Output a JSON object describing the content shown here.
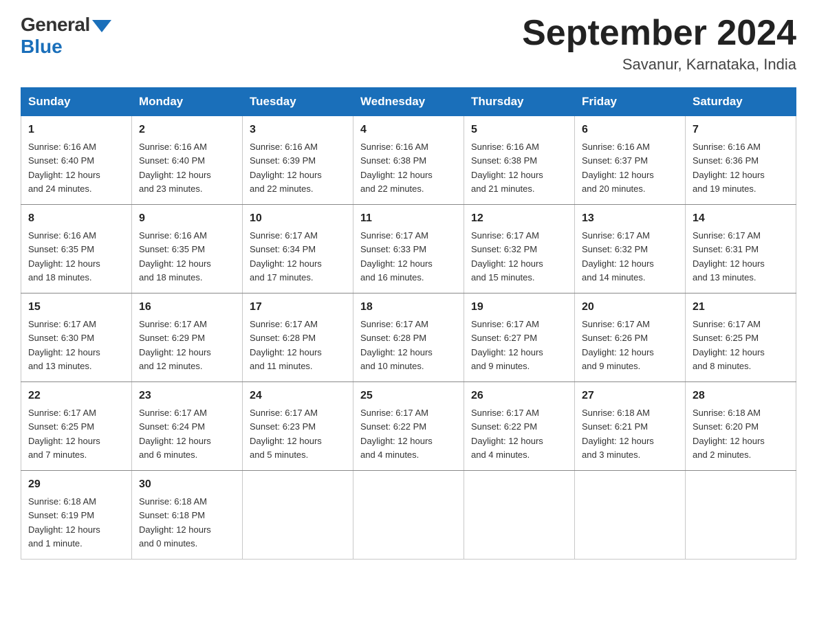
{
  "logo": {
    "general": "General",
    "blue": "Blue"
  },
  "title": "September 2024",
  "location": "Savanur, Karnataka, India",
  "days_of_week": [
    "Sunday",
    "Monday",
    "Tuesday",
    "Wednesday",
    "Thursday",
    "Friday",
    "Saturday"
  ],
  "weeks": [
    [
      {
        "day": "1",
        "sunrise": "6:16 AM",
        "sunset": "6:40 PM",
        "daylight": "12 hours and 24 minutes."
      },
      {
        "day": "2",
        "sunrise": "6:16 AM",
        "sunset": "6:40 PM",
        "daylight": "12 hours and 23 minutes."
      },
      {
        "day": "3",
        "sunrise": "6:16 AM",
        "sunset": "6:39 PM",
        "daylight": "12 hours and 22 minutes."
      },
      {
        "day": "4",
        "sunrise": "6:16 AM",
        "sunset": "6:38 PM",
        "daylight": "12 hours and 22 minutes."
      },
      {
        "day": "5",
        "sunrise": "6:16 AM",
        "sunset": "6:38 PM",
        "daylight": "12 hours and 21 minutes."
      },
      {
        "day": "6",
        "sunrise": "6:16 AM",
        "sunset": "6:37 PM",
        "daylight": "12 hours and 20 minutes."
      },
      {
        "day": "7",
        "sunrise": "6:16 AM",
        "sunset": "6:36 PM",
        "daylight": "12 hours and 19 minutes."
      }
    ],
    [
      {
        "day": "8",
        "sunrise": "6:16 AM",
        "sunset": "6:35 PM",
        "daylight": "12 hours and 18 minutes."
      },
      {
        "day": "9",
        "sunrise": "6:16 AM",
        "sunset": "6:35 PM",
        "daylight": "12 hours and 18 minutes."
      },
      {
        "day": "10",
        "sunrise": "6:17 AM",
        "sunset": "6:34 PM",
        "daylight": "12 hours and 17 minutes."
      },
      {
        "day": "11",
        "sunrise": "6:17 AM",
        "sunset": "6:33 PM",
        "daylight": "12 hours and 16 minutes."
      },
      {
        "day": "12",
        "sunrise": "6:17 AM",
        "sunset": "6:32 PM",
        "daylight": "12 hours and 15 minutes."
      },
      {
        "day": "13",
        "sunrise": "6:17 AM",
        "sunset": "6:32 PM",
        "daylight": "12 hours and 14 minutes."
      },
      {
        "day": "14",
        "sunrise": "6:17 AM",
        "sunset": "6:31 PM",
        "daylight": "12 hours and 13 minutes."
      }
    ],
    [
      {
        "day": "15",
        "sunrise": "6:17 AM",
        "sunset": "6:30 PM",
        "daylight": "12 hours and 13 minutes."
      },
      {
        "day": "16",
        "sunrise": "6:17 AM",
        "sunset": "6:29 PM",
        "daylight": "12 hours and 12 minutes."
      },
      {
        "day": "17",
        "sunrise": "6:17 AM",
        "sunset": "6:28 PM",
        "daylight": "12 hours and 11 minutes."
      },
      {
        "day": "18",
        "sunrise": "6:17 AM",
        "sunset": "6:28 PM",
        "daylight": "12 hours and 10 minutes."
      },
      {
        "day": "19",
        "sunrise": "6:17 AM",
        "sunset": "6:27 PM",
        "daylight": "12 hours and 9 minutes."
      },
      {
        "day": "20",
        "sunrise": "6:17 AM",
        "sunset": "6:26 PM",
        "daylight": "12 hours and 9 minutes."
      },
      {
        "day": "21",
        "sunrise": "6:17 AM",
        "sunset": "6:25 PM",
        "daylight": "12 hours and 8 minutes."
      }
    ],
    [
      {
        "day": "22",
        "sunrise": "6:17 AM",
        "sunset": "6:25 PM",
        "daylight": "12 hours and 7 minutes."
      },
      {
        "day": "23",
        "sunrise": "6:17 AM",
        "sunset": "6:24 PM",
        "daylight": "12 hours and 6 minutes."
      },
      {
        "day": "24",
        "sunrise": "6:17 AM",
        "sunset": "6:23 PM",
        "daylight": "12 hours and 5 minutes."
      },
      {
        "day": "25",
        "sunrise": "6:17 AM",
        "sunset": "6:22 PM",
        "daylight": "12 hours and 4 minutes."
      },
      {
        "day": "26",
        "sunrise": "6:17 AM",
        "sunset": "6:22 PM",
        "daylight": "12 hours and 4 minutes."
      },
      {
        "day": "27",
        "sunrise": "6:18 AM",
        "sunset": "6:21 PM",
        "daylight": "12 hours and 3 minutes."
      },
      {
        "day": "28",
        "sunrise": "6:18 AM",
        "sunset": "6:20 PM",
        "daylight": "12 hours and 2 minutes."
      }
    ],
    [
      {
        "day": "29",
        "sunrise": "6:18 AM",
        "sunset": "6:19 PM",
        "daylight": "12 hours and 1 minute."
      },
      {
        "day": "30",
        "sunrise": "6:18 AM",
        "sunset": "6:18 PM",
        "daylight": "12 hours and 0 minutes."
      },
      null,
      null,
      null,
      null,
      null
    ]
  ]
}
